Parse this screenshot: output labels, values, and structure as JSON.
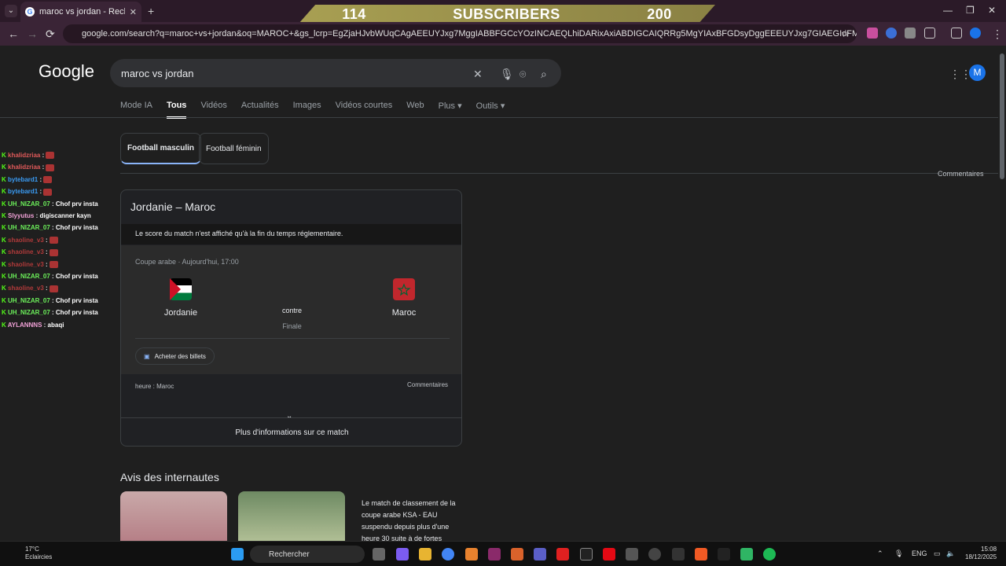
{
  "browser": {
    "tab_title": "maroc vs jordan - Recherche Go",
    "tab_close": "✕",
    "new_tab": "+",
    "url": "google.com/search?q=maroc+vs+jordan&oq=MAROC+&gs_lcrp=EgZjaHJvbWUqCAgAEEUYJxg7MggIABBFGCcYOzINCAEQLhiDARixAxiABDIGCAIQRRg5MgYIAxBFGDsyDggEEEUYJxg7GIAEGIoFMgYIBRBFGD0yBggGEEUYPTIGCAcQR...",
    "nav_back": "←",
    "nav_forward": "→",
    "nav_reload": "⟳",
    "minimize": "—",
    "maximize": "❐",
    "close": "✕"
  },
  "overlay_banner": {
    "left_number": "114",
    "label": "SUBSCRIBERS",
    "right_number": "200"
  },
  "google": {
    "logo": "Google",
    "query": "maroc vs jordan",
    "tabs": [
      "Mode IA",
      "Tous",
      "Vidéos",
      "Actualités",
      "Images",
      "Vidéos courtes",
      "Web",
      "Plus ▾",
      "Outils ▾"
    ],
    "active_tab": "Tous",
    "avatar_letter": "M",
    "chips": [
      "Football masculin",
      "Football féminin"
    ],
    "comments_link": "Commentaires"
  },
  "match_card": {
    "title": "Jordanie – Maroc",
    "note": "Le score du match n'est affiché qu'à la fin du temps réglementaire.",
    "competition": "Coupe arabe · Aujourd'hui, 17:00",
    "home_team": "Jordanie",
    "away_team": "Maroc",
    "versus": "contre",
    "stage": "Finale",
    "tickets_button": "Acheter des billets",
    "timezone": "heure : Maroc",
    "comments": "Commentaires",
    "more_info": "Plus d'informations sur ce match",
    "expand_chevron": "⌄"
  },
  "reviews": {
    "heading": "Avis des internautes",
    "text": "Le match de classement de la coupe arabe KSA - EAU suspendu depuis plus d'une heure 30 suite à de fortes"
  },
  "chat": [
    {
      "user": "khalidzriaa",
      "msg": "",
      "color": "#e05a5a"
    },
    {
      "user": "khalidzriaa",
      "msg": "",
      "color": "#e05a5a"
    },
    {
      "user": "bytebard1",
      "msg": "",
      "color": "#3a9cf5"
    },
    {
      "user": "bytebard1",
      "msg": "",
      "color": "#3a9cf5"
    },
    {
      "user": "UH_NIZAR_07",
      "msg": "Chof prv insta",
      "color": "#6cf05a"
    },
    {
      "user": "Slyyutus",
      "msg": "digiscanner kayn",
      "color": "#f2a2d8"
    },
    {
      "user": "UH_NIZAR_07",
      "msg": "Chof prv insta",
      "color": "#6cf05a"
    },
    {
      "user": "shaoline_v3",
      "msg": "",
      "color": "#b03a3a"
    },
    {
      "user": "shaoline_v3",
      "msg": "",
      "color": "#b03a3a"
    },
    {
      "user": "shaoline_v3",
      "msg": "",
      "color": "#b03a3a"
    },
    {
      "user": "UH_NIZAR_07",
      "msg": "Chof prv insta",
      "color": "#6cf05a"
    },
    {
      "user": "shaoline_v3",
      "msg": "",
      "color": "#b03a3a"
    },
    {
      "user": "UH_NIZAR_07",
      "msg": "Chof prv insta",
      "color": "#6cf05a"
    },
    {
      "user": "UH_NIZAR_07",
      "msg": "Chof prv insta",
      "color": "#6cf05a"
    },
    {
      "user": "AYLANNNS",
      "msg": "abaqi",
      "color": "#f2a2d8"
    }
  ],
  "taskbar": {
    "temperature": "17°C",
    "weather": "Eclaircies",
    "search_label": "Rechercher",
    "lang": "ENG",
    "time": "15:08",
    "date": "18/12/2025"
  },
  "colors": {
    "accent_blue": "#8ab4f8",
    "chat_badge_green": "#53fc18",
    "banner_gold": "#a89f52"
  }
}
